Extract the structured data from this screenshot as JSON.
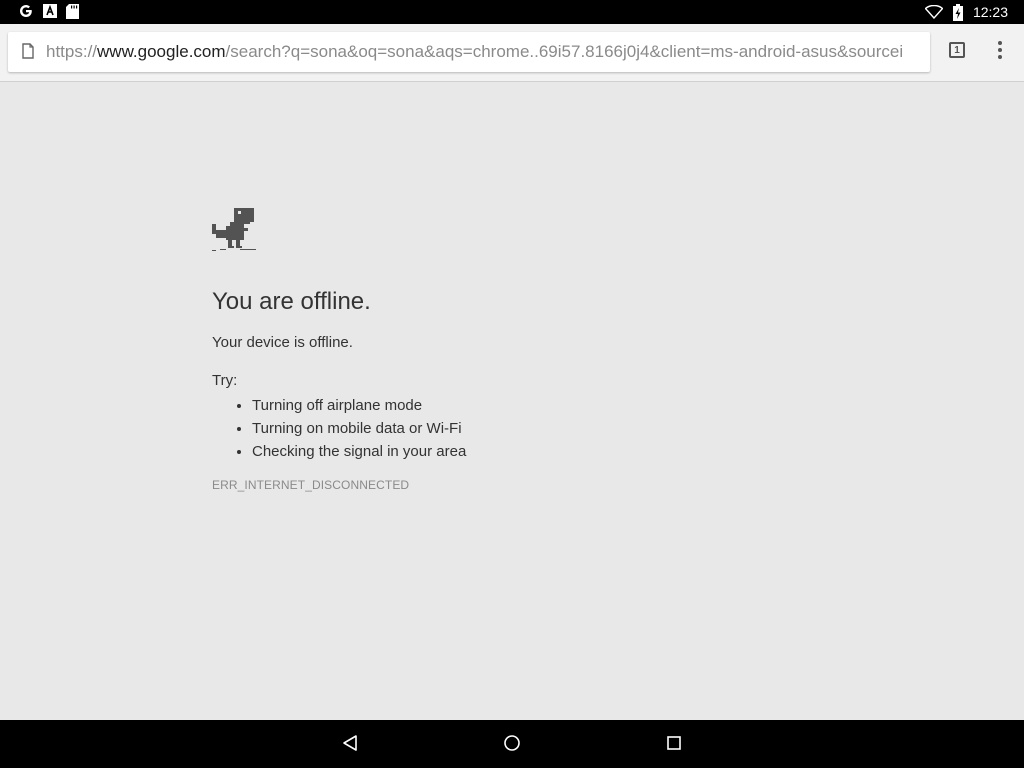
{
  "status_bar": {
    "time": "12:23",
    "left_icons": [
      "google-g-icon",
      "font-a-icon",
      "sd-card-icon"
    ],
    "right_icons": [
      "wifi-icon",
      "battery-charging-icon"
    ]
  },
  "toolbar": {
    "url_scheme": "https://",
    "url_host": "www.google.com",
    "url_path": "/search?q=sona&oq=sona&aqs=chrome..69i57.8166j0j4&client=ms-android-asus&sourcei",
    "tab_count": "1"
  },
  "error_page": {
    "title": "You are offline.",
    "message": "Your device is offline.",
    "try_label": "Try:",
    "suggestions": [
      "Turning off airplane mode",
      "Turning on mobile data or Wi-Fi",
      "Checking the signal in your area"
    ],
    "error_code": "ERR_INTERNET_DISCONNECTED"
  },
  "nav_bar": {
    "buttons": [
      "back-icon",
      "home-icon",
      "recents-icon"
    ]
  },
  "colors": {
    "page_bg": "#e8e8e8",
    "text": "#333333",
    "muted_text": "#8a8a8a",
    "dino": "#535353"
  }
}
